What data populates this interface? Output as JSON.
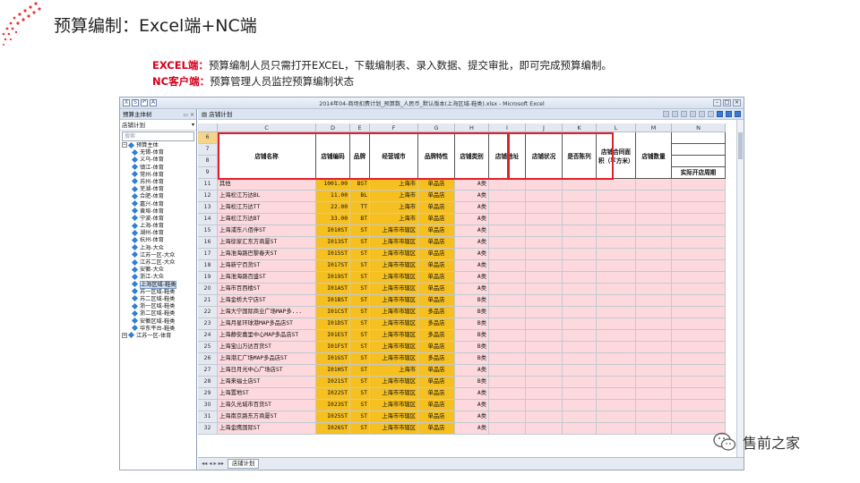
{
  "slide": {
    "title": "预算编制：Excel端+NC端",
    "lines": [
      {
        "lead": "EXCEL端：",
        "text": "预算编制人员只需打开EXCEL，下载编制表、录入数据、提交审批，即可完成预算编制。"
      },
      {
        "lead": "NC客户端：",
        "text": "预算管理人员监控预算编制状态"
      }
    ]
  },
  "excel": {
    "window_title": "2014年04-商场扣费计划_预算数_人民币_默认版本(上海区域-鞋类).xlsx - Microsoft Excel",
    "quick_access": [
      "X",
      "S",
      "↶",
      "A"
    ],
    "left_pane": {
      "header": "预算主体树",
      "selector": "店铺计划",
      "search_placeholder": "搜索",
      "root": "预算主体",
      "items": [
        "无锡-体育",
        "义乌-体育",
        "镇江-体育",
        "常州-体育",
        "苏州-体育",
        "芜湖-体育",
        "合肥-体育",
        "嘉兴-体育",
        "黄埠-体育",
        "宁波-体育",
        "上海-体育",
        "湖州-体育",
        "杭州-体育",
        "上海-大众",
        "江苏一区-大众",
        "江苏二区-大众",
        "安徽-大众",
        "浙江-大众",
        "上海区域-鞋类",
        "苏一区域-鞋类",
        "苏二区域-鞋类",
        "浙一区域-鞋类",
        "浙二区域-鞋类",
        "安徽区域-鞋类",
        "华东平台-鞋类",
        "江苏一区-体育"
      ],
      "selected": "上海区域-鞋类"
    },
    "sheet_tab_title": "店铺计划",
    "columns": [
      "C",
      "D",
      "E",
      "F",
      "G",
      "H",
      "I",
      "J",
      "K",
      "L",
      "M",
      "N"
    ],
    "header_rows": [
      "6",
      "7",
      "8",
      "9"
    ],
    "headers": {
      "C": "店铺名称",
      "D": "店铺编码",
      "E": "品牌",
      "F": "经营城市",
      "G": "品牌特性",
      "H": "店铺类别",
      "I": "店铺地址",
      "J": "店铺状况",
      "K": "是否陈列",
      "L": "店铺合同面积（平方米）",
      "M": "店铺数量",
      "N": "实际开店周期"
    },
    "rows": [
      {
        "n": "11",
        "name": "其他",
        "code": "1001.00",
        "brand": "BST",
        "city": "上海市",
        "feat": "单品店",
        "cat": "A类"
      },
      {
        "n": "12",
        "name": "上海松江万达BL",
        "code": "11.00",
        "brand": "BL",
        "city": "上海市",
        "feat": "单品店",
        "cat": "A类"
      },
      {
        "n": "13",
        "name": "上海松江万达TT",
        "code": "22.00",
        "brand": "TT",
        "city": "上海市",
        "feat": "单品店",
        "cat": "A类"
      },
      {
        "n": "14",
        "name": "上海松江万达BT",
        "code": "33.00",
        "brand": "BT",
        "city": "上海市",
        "feat": "单品店",
        "cat": "A类"
      },
      {
        "n": "15",
        "name": "上海浦东八佰伴ST",
        "code": "I010ST",
        "brand": "ST",
        "city": "上海市市辖区",
        "feat": "单品店",
        "cat": "A类"
      },
      {
        "n": "16",
        "name": "上海徐家汇东方商厦ST",
        "code": "I013ST",
        "brand": "ST",
        "city": "上海市市辖区",
        "feat": "单品店",
        "cat": "A类"
      },
      {
        "n": "17",
        "name": "上海淮海路巴黎春天ST",
        "code": "I015ST",
        "brand": "ST",
        "city": "上海市市辖区",
        "feat": "单品店",
        "cat": "A类"
      },
      {
        "n": "18",
        "name": "上海新宁百货ST",
        "code": "I017ST",
        "brand": "ST",
        "city": "上海市市辖区",
        "feat": "单品店",
        "cat": "A类"
      },
      {
        "n": "19",
        "name": "上海淮海路百盛ST",
        "code": "I019ST",
        "brand": "ST",
        "city": "上海市市辖区",
        "feat": "单品店",
        "cat": "A类"
      },
      {
        "n": "20",
        "name": "上海市百西楼ST",
        "code": "I01AST",
        "brand": "ST",
        "city": "上海市市辖区",
        "feat": "单品店",
        "cat": "A类"
      },
      {
        "n": "21",
        "name": "上海金桥大宁店ST",
        "code": "I01BST",
        "brand": "ST",
        "city": "上海市市辖区",
        "feat": "单品店",
        "cat": "B类"
      },
      {
        "n": "22",
        "name": "上海大宁国际商业广场MAP多...",
        "code": "I01CST",
        "brand": "ST",
        "city": "上海市市辖区",
        "feat": "多品店",
        "cat": "B类"
      },
      {
        "n": "23",
        "name": "上海月星环球港MAP多品店ST",
        "code": "I01DST",
        "brand": "ST",
        "city": "上海市市辖区",
        "feat": "多品店",
        "cat": "B类"
      },
      {
        "n": "24",
        "name": "上海静安嘉里中心MAP多品店ST",
        "code": "I01EST",
        "brand": "ST",
        "city": "上海市市辖区",
        "feat": "多品店",
        "cat": "B类"
      },
      {
        "n": "25",
        "name": "上海宝山万达百货ST",
        "code": "I01FST",
        "brand": "ST",
        "city": "上海市市辖区",
        "feat": "单品店",
        "cat": "B类"
      },
      {
        "n": "26",
        "name": "上海港汇广场MAP多品店ST",
        "code": "I01GST",
        "brand": "ST",
        "city": "上海市市辖区",
        "feat": "多品店",
        "cat": "B类"
      },
      {
        "n": "27",
        "name": "上海日月光中心广场店ST",
        "code": "I01HST",
        "brand": "ST",
        "city": "上海市",
        "feat": "单品店",
        "cat": "A类"
      },
      {
        "n": "28",
        "name": "上海来福士店ST",
        "code": "I021ST",
        "brand": "ST",
        "city": "上海市市辖区",
        "feat": "单品店",
        "cat": "B类"
      },
      {
        "n": "29",
        "name": "上海置地ST",
        "code": "I022ST",
        "brand": "ST",
        "city": "上海市市辖区",
        "feat": "单品店",
        "cat": "A类"
      },
      {
        "n": "30",
        "name": "上海久光城市百货ST",
        "code": "I023ST",
        "brand": "ST",
        "city": "上海市市辖区",
        "feat": "单品店",
        "cat": "A类"
      },
      {
        "n": "31",
        "name": "上海南京路东方商厦ST",
        "code": "I025ST",
        "brand": "ST",
        "city": "上海市市辖区",
        "feat": "单品店",
        "cat": "A类"
      },
      {
        "n": "32",
        "name": "上海金鹰国际ST",
        "code": "I026ST",
        "brand": "ST",
        "city": "上海市市辖区",
        "feat": "单品店",
        "cat": "A类"
      }
    ],
    "sheet_tabs": [
      "店铺计划"
    ]
  },
  "brand": {
    "name": "售前之家"
  },
  "colors": {
    "accent": "#d6001c",
    "required_cell": "#f6c020",
    "input_cell": "#fdd9dd",
    "highlight_box": "#e0202a"
  }
}
